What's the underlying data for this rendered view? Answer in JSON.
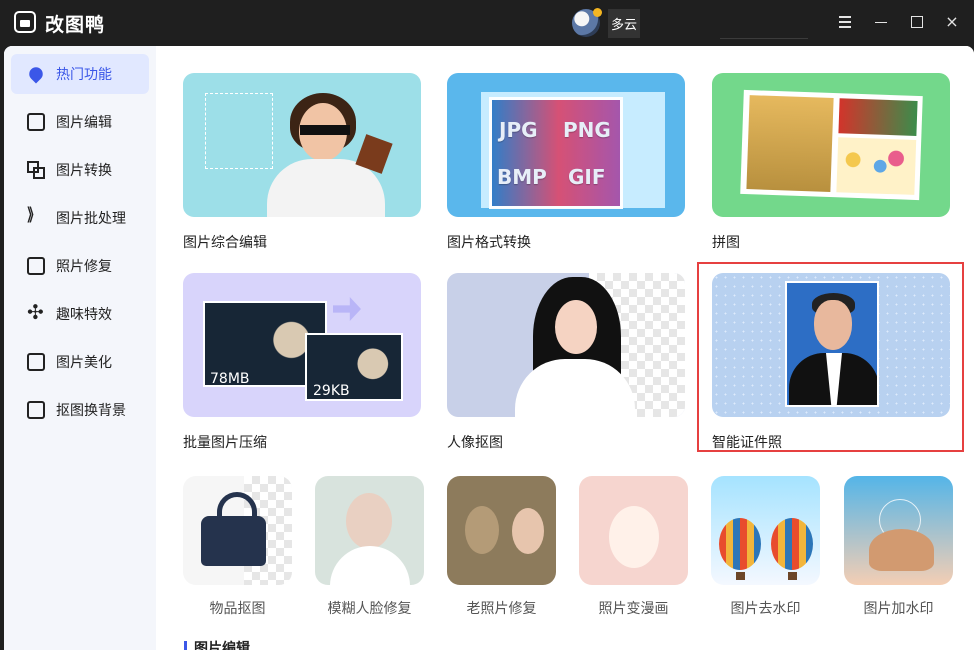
{
  "app": {
    "title": "改图鸭",
    "weather": "多云"
  },
  "sidebar": {
    "items": [
      {
        "label": "热门功能",
        "active": true
      },
      {
        "label": "图片编辑",
        "active": false
      },
      {
        "label": "图片转换",
        "active": false
      },
      {
        "label": "图片批处理",
        "active": false
      },
      {
        "label": "照片修复",
        "active": false
      },
      {
        "label": "趣味特效",
        "active": false
      },
      {
        "label": "图片美化",
        "active": false
      },
      {
        "label": "抠图换背景",
        "active": false
      }
    ]
  },
  "featured": [
    {
      "label": "图片综合编辑"
    },
    {
      "label": "图片格式转换",
      "formats": [
        "JPG",
        "PNG",
        "BMP",
        "GIF"
      ]
    },
    {
      "label": "拼图"
    },
    {
      "label": "批量图片压缩",
      "sizes": [
        "78MB",
        "29KB"
      ]
    },
    {
      "label": "人像抠图"
    },
    {
      "label": "智能证件照",
      "selected": true
    }
  ],
  "tools": [
    {
      "label": "物品抠图"
    },
    {
      "label": "模糊人脸修复"
    },
    {
      "label": "老照片修复"
    },
    {
      "label": "照片变漫画"
    },
    {
      "label": "图片去水印"
    },
    {
      "label": "图片加水印"
    }
  ],
  "section": {
    "title": "图片编辑"
  },
  "colors": {
    "accent": "#3b57e8",
    "selection": "#e64040",
    "titlebar": "#1f1f1f"
  }
}
